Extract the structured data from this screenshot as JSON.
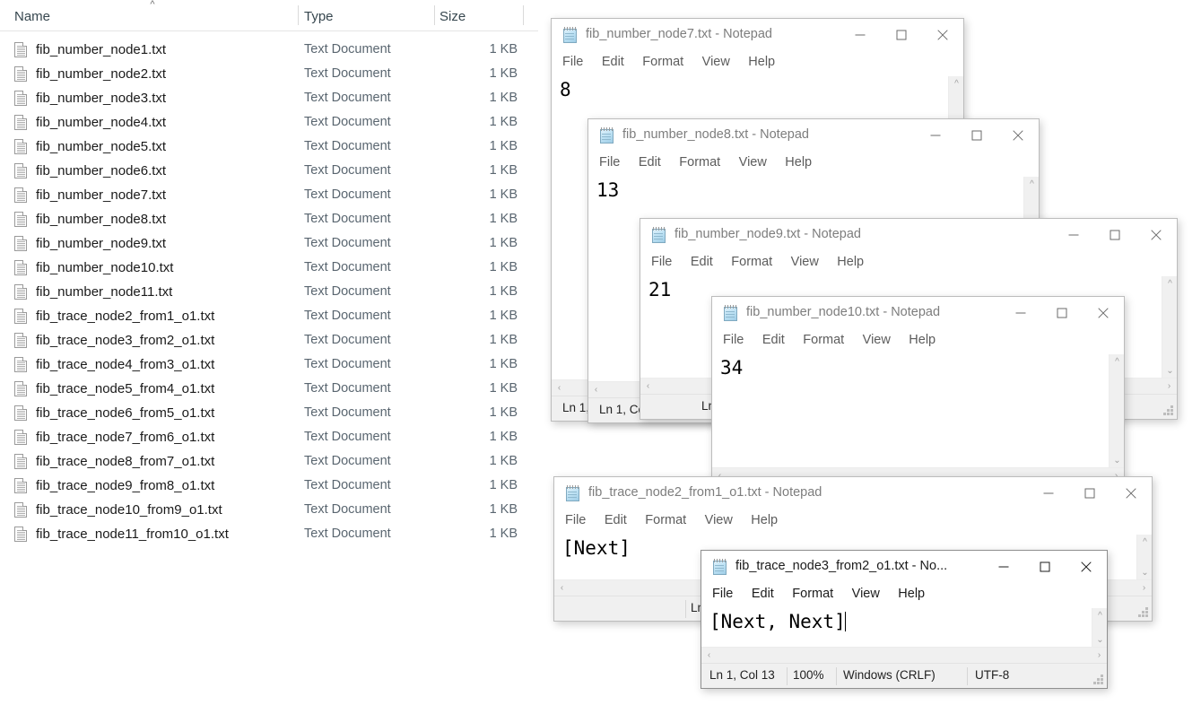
{
  "explorer": {
    "columns": [
      {
        "label": "Name",
        "sort": "ascending"
      },
      {
        "label": "Type"
      },
      {
        "label": "Size"
      }
    ],
    "sort_icon": "chevron-up-icon",
    "files": [
      {
        "name": "fib_number_node1.txt",
        "type": "Text Document",
        "size": "1 KB"
      },
      {
        "name": "fib_number_node2.txt",
        "type": "Text Document",
        "size": "1 KB"
      },
      {
        "name": "fib_number_node3.txt",
        "type": "Text Document",
        "size": "1 KB"
      },
      {
        "name": "fib_number_node4.txt",
        "type": "Text Document",
        "size": "1 KB"
      },
      {
        "name": "fib_number_node5.txt",
        "type": "Text Document",
        "size": "1 KB"
      },
      {
        "name": "fib_number_node6.txt",
        "type": "Text Document",
        "size": "1 KB"
      },
      {
        "name": "fib_number_node7.txt",
        "type": "Text Document",
        "size": "1 KB"
      },
      {
        "name": "fib_number_node8.txt",
        "type": "Text Document",
        "size": "1 KB"
      },
      {
        "name": "fib_number_node9.txt",
        "type": "Text Document",
        "size": "1 KB"
      },
      {
        "name": "fib_number_node10.txt",
        "type": "Text Document",
        "size": "1 KB"
      },
      {
        "name": "fib_number_node11.txt",
        "type": "Text Document",
        "size": "1 KB"
      },
      {
        "name": "fib_trace_node2_from1_o1.txt",
        "type": "Text Document",
        "size": "1 KB"
      },
      {
        "name": "fib_trace_node3_from2_o1.txt",
        "type": "Text Document",
        "size": "1 KB"
      },
      {
        "name": "fib_trace_node4_from3_o1.txt",
        "type": "Text Document",
        "size": "1 KB"
      },
      {
        "name": "fib_trace_node5_from4_o1.txt",
        "type": "Text Document",
        "size": "1 KB"
      },
      {
        "name": "fib_trace_node6_from5_o1.txt",
        "type": "Text Document",
        "size": "1 KB"
      },
      {
        "name": "fib_trace_node7_from6_o1.txt",
        "type": "Text Document",
        "size": "1 KB"
      },
      {
        "name": "fib_trace_node8_from7_o1.txt",
        "type": "Text Document",
        "size": "1 KB"
      },
      {
        "name": "fib_trace_node9_from8_o1.txt",
        "type": "Text Document",
        "size": "1 KB"
      },
      {
        "name": "fib_trace_node10_from9_o1.txt",
        "type": "Text Document",
        "size": "1 KB"
      },
      {
        "name": "fib_trace_node11_from10_o1.txt",
        "type": "Text Document",
        "size": "1 KB"
      }
    ]
  },
  "menu": {
    "file": "File",
    "edit": "Edit",
    "format": "Format",
    "view": "View",
    "help": "Help"
  },
  "window_buttons": {
    "minimize": "minimize-icon",
    "maximize": "maximize-icon",
    "close": "close-icon"
  },
  "windows": [
    {
      "id": "np-node7",
      "title": "fib_number_node7.txt - Notepad",
      "content": "8",
      "status": {
        "position": "Ln 1,"
      }
    },
    {
      "id": "np-node8",
      "title": "fib_number_node8.txt - Notepad",
      "content": "13",
      "status": {
        "position": "Ln 1, Co"
      }
    },
    {
      "id": "np-node9",
      "title": "fib_number_node9.txt - Notepad",
      "content": "21",
      "status": {
        "position": "Ln"
      }
    },
    {
      "id": "np-node10",
      "title": "fib_number_node10.txt - Notepad",
      "content": "34",
      "status": {
        "position": ""
      }
    },
    {
      "id": "np-trace2",
      "title": "fib_trace_node2_from1_o1.txt - Notepad",
      "content": "[Next]",
      "status": {
        "position": "Ln"
      }
    },
    {
      "id": "np-trace3",
      "title": "fib_trace_node3_from2_o1.txt - No...",
      "content": "[Next, Next]",
      "active": true,
      "status": {
        "position": "Ln 1, Col 13",
        "zoom": "100%",
        "line_ending": "Windows (CRLF)",
        "encoding": "UTF-8"
      }
    }
  ]
}
